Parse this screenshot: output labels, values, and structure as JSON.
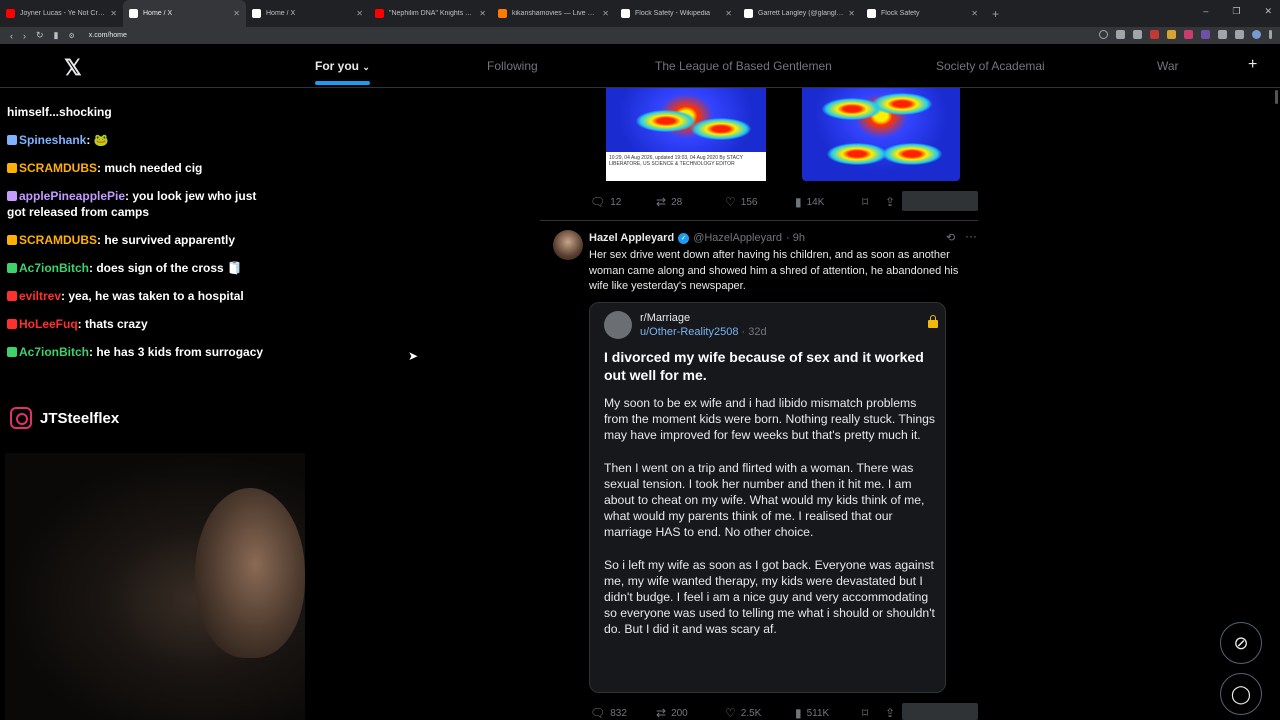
{
  "browser": {
    "tabs": [
      {
        "label": "Joyner Lucas - Ye Not Crazy (Official",
        "color": "#ff0000"
      },
      {
        "label": "Home / X",
        "color": "#ffffff",
        "active": true
      },
      {
        "label": "Home / X",
        "color": "#ffffff"
      },
      {
        "label": "\"Nephilim DNA\" Knights Templar, Re",
        "color": "#ff0000"
      },
      {
        "label": "kikanshamovies — Live Movie Chann",
        "color": "#ff7a00"
      },
      {
        "label": "Flock Safety - Wikipedia",
        "color": "#ffffff"
      },
      {
        "label": "Garrett Langley (@glangley) / X",
        "color": "#ffffff"
      },
      {
        "label": "Flock Safety",
        "color": "#ffffff"
      }
    ],
    "url": "x.com/home"
  },
  "x": {
    "logo": "𝕏",
    "tabs": [
      "For you",
      "Following",
      "The League of Based Gentlemen",
      "Society of Academai",
      "War"
    ]
  },
  "chat": [
    {
      "user": "",
      "text": "himself...shocking"
    },
    {
      "user": "Spineshank",
      "text": ": 🐸",
      "color": "#7fb2ff"
    },
    {
      "user": "SCRAMDUBS",
      "text": ": much needed cig",
      "color": "#ffb000"
    },
    {
      "user": "applePineapplePie",
      "text": ": you look jew who just got released from camps",
      "color": "#c49bff"
    },
    {
      "user": "SCRAMDUBS",
      "text": ": he survived apparently",
      "color": "#ffb000"
    },
    {
      "user": "Ac7ionBitch",
      "text": ": does sign of the cross 🧻",
      "color": "#3fd16c"
    },
    {
      "user": "eviltrev",
      "text": ": yea, he was taken to a hospital",
      "color": "#ff3030"
    },
    {
      "user": "HoLeeFuq",
      "text": ": thats crazy",
      "color": "#ff3030"
    },
    {
      "user": "Ac7ionBitch",
      "text": ": he has 3 kids from surrogacy",
      "color": "#3fd16c"
    }
  ],
  "instagram": {
    "handle": "JTSteelflex"
  },
  "prev_tweet": {
    "caption": "10:29, 04 Aug 2026, updated 19:03, 04 Aug 2020 By STACY LIBERATORE, US SCIENCE & TECHNOLOGY EDITOR",
    "replies": "12",
    "reposts": "28",
    "likes": "156",
    "views": "14K"
  },
  "tweet": {
    "name": "Hazel Appleyard",
    "handle": "@HazelAppleyard",
    "time": "· 9h",
    "text": "Her sex drive went down after having his children, and as soon as another woman came along and showed him a shred of attention, he abandoned his wife like yesterday's newspaper.",
    "card": {
      "subreddit": "r/Marriage",
      "user": "u/Other-Reality2508",
      "age": "· 32d",
      "title": "I divorced my wife because of sex and it worked out well for me.",
      "paragraphs": [
        "My soon to be ex wife and i had libido mismatch problems from the moment kids were born. Nothing really stuck. Things may have improved for few weeks but that's pretty much it.",
        "Then I went on a trip and flirted with a woman. There was sexual tension. I took her number and then it hit me. I am about to cheat on my wife. What would my kids think of me, what would my parents think of me. I realised that our marriage HAS to end. No other choice.",
        "So i left my wife as soon as I got back. Everyone was against me, my wife wanted therapy, my kids were devastated but I didn't budge. I feel i am a nice guy and very accommodating so everyone was used to telling me what i should or shouldn't do. But I did it and was scary af."
      ]
    },
    "replies": "832",
    "reposts": "200",
    "likes": "2.5K",
    "views": "511K"
  }
}
